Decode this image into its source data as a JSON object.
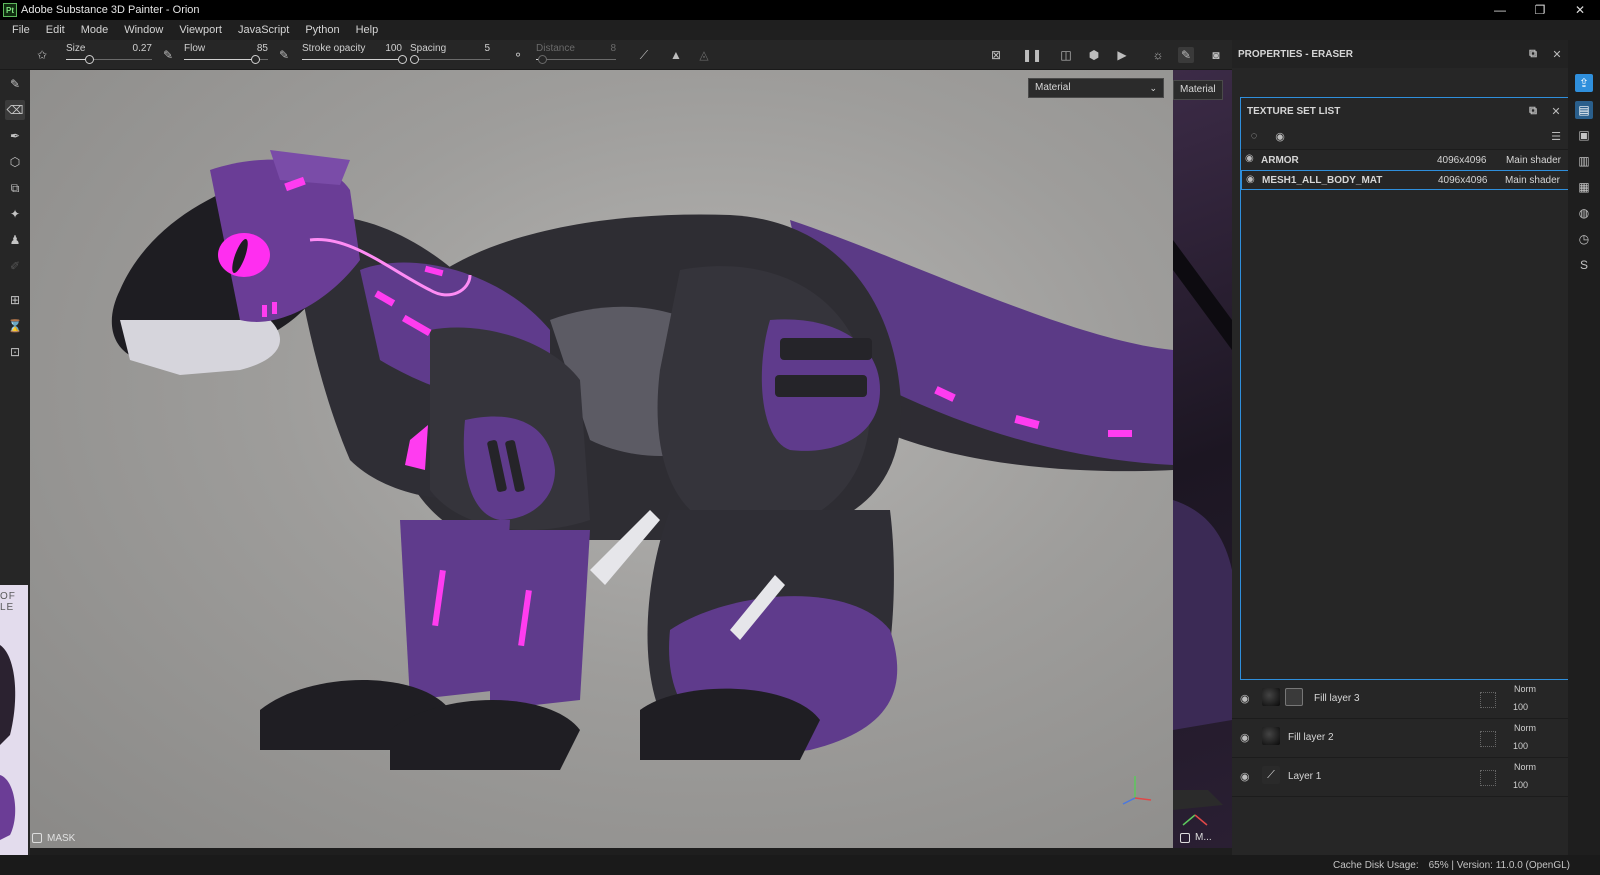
{
  "window": {
    "logo_text": "Pt",
    "title": "Adobe Substance 3D Painter - Orion",
    "minimize": "—",
    "restore": "❐",
    "close": "✕"
  },
  "menu": [
    "File",
    "Edit",
    "Mode",
    "Window",
    "Viewport",
    "JavaScript",
    "Python",
    "Help"
  ],
  "toolbar": {
    "size": {
      "label": "Size",
      "value": "0.27",
      "fraction": 0.27
    },
    "flow": {
      "label": "Flow",
      "value": "85",
      "fraction": 0.85
    },
    "stroke_opacity": {
      "label": "Stroke opacity",
      "value": "100",
      "fraction": 1.0
    },
    "spacing": {
      "label": "Spacing",
      "value": "5",
      "fraction": 0.05
    },
    "distance": {
      "label": "Distance",
      "value": "8",
      "fraction": 0.08
    }
  },
  "viewport": {
    "material_dropdown": "Material",
    "mask_label": "MASK"
  },
  "uv_view": {
    "material_dropdown": "Material",
    "bottom_label": "M..."
  },
  "thumbnail_edge": {
    "text": "OF LE"
  },
  "properties_panel": {
    "title": "PROPERTIES - ERASER"
  },
  "texture_set_list": {
    "title": "TEXTURE SET LIST",
    "rows": [
      {
        "name": "ARMOR",
        "resolution": "4096x4096",
        "shader": "Main shader"
      },
      {
        "name": "MESH1_ALL_BODY_MAT",
        "resolution": "4096x4096",
        "shader": "Main shader"
      }
    ]
  },
  "layers": [
    {
      "name": "Fill layer 3",
      "blend": "Norm",
      "opacity": "100"
    },
    {
      "name": "Fill layer 2",
      "blend": "Norm",
      "opacity": "100"
    },
    {
      "name": "Layer 1",
      "blend": "Norm",
      "opacity": "100"
    }
  ],
  "status": {
    "cache_label": "Cache Disk Usage:",
    "cache_value": "65% | Version: 11.0.0 (OpenGL)"
  },
  "colors": {
    "accent": "#2f8fdc",
    "armor_purple": "#6a3d96",
    "neon_pink": "#ff3cf0",
    "body_dark": "#2c2c30"
  }
}
